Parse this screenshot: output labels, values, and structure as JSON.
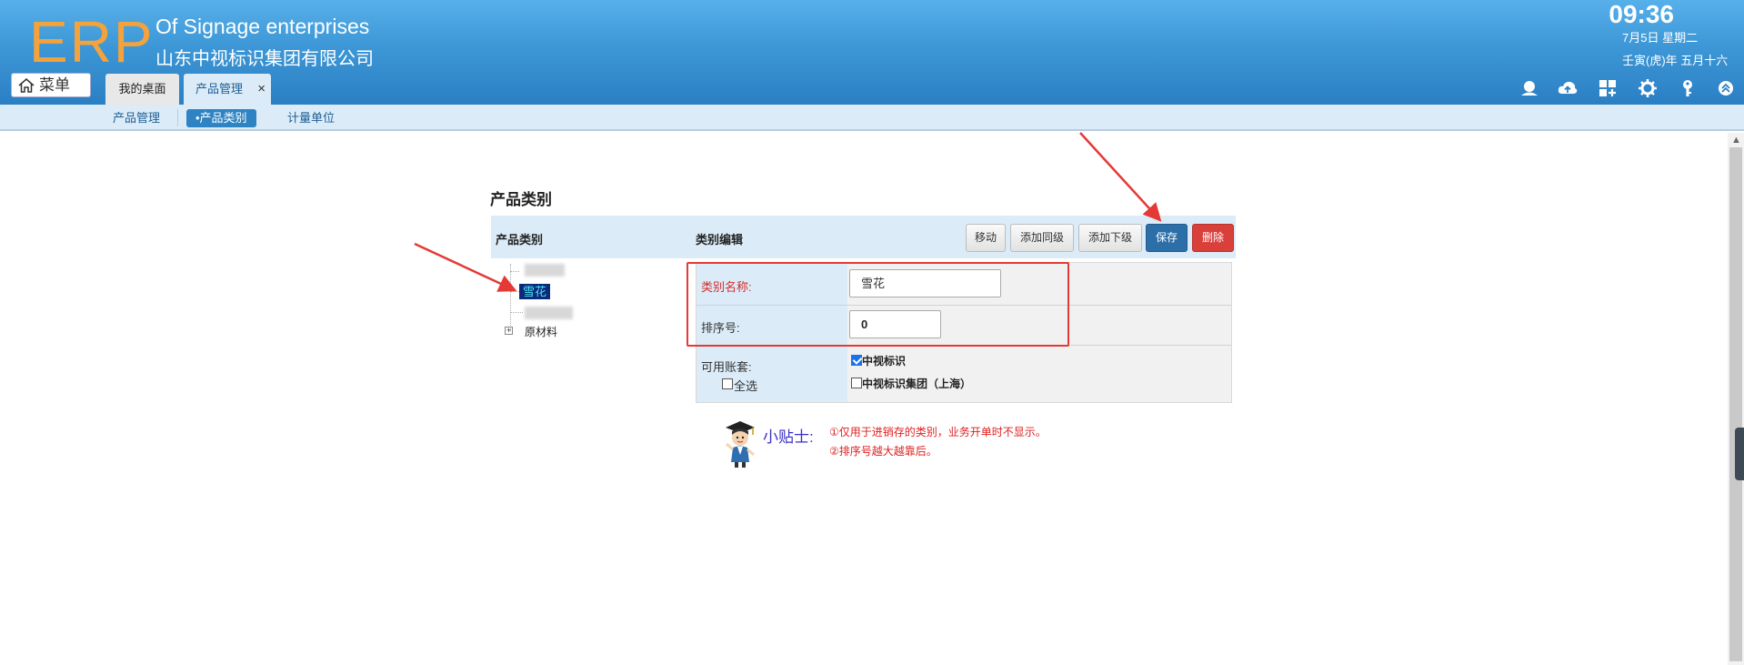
{
  "header": {
    "logo": "ERP",
    "company_en": "Of Signage enterprises",
    "company_cn": "山东中视标识集团有限公司",
    "time": "09:36",
    "date": "7月5日 星期二",
    "lunar_date": "壬寅(虎)年 五月十六",
    "menu_label": "菜单",
    "tabs": [
      {
        "label": "我的桌面"
      },
      {
        "label": "产品管理",
        "close": "×"
      }
    ],
    "icons": [
      "user-icon",
      "cloud-upload-icon",
      "apps-icon",
      "gear-icon",
      "key-icon",
      "collapse-up-icon"
    ]
  },
  "subnav": {
    "items": [
      {
        "label": "产品管理"
      },
      {
        "label": "•产品类别"
      },
      {
        "label": "计量单位"
      }
    ]
  },
  "main": {
    "heading": "产品类别",
    "panel": {
      "tree_header": "产品类别",
      "edit_header": "类别编辑",
      "buttons": {
        "move": "移动",
        "add_sibling": "添加同级",
        "add_child": "添加下级",
        "save": "保存",
        "delete": "删除"
      }
    },
    "tree": {
      "selected": "雪花",
      "raw_material": "原材料",
      "expander": "+"
    },
    "form": {
      "name_label": "类别名称:",
      "name_value": "雪花",
      "order_label": "排序号:",
      "order_value": "0",
      "accounts_label": "可用账套:",
      "select_all_label": "全选",
      "select_all_checked": false,
      "accounts": [
        {
          "label": "中视标识",
          "checked": true
        },
        {
          "label": "中视标识集团（上海）",
          "checked": false
        }
      ]
    },
    "tips": {
      "title": "小贴士:",
      "lines": [
        "①仅用于进销存的类别，业务开单时不显示。",
        "②排序号越大越靠后。"
      ]
    }
  },
  "colors": {
    "header_blue": "#3d97d6",
    "logo_orange": "#f4a23b",
    "save_blue": "#2c6ea8",
    "delete_red": "#d9403a",
    "annotation_red": "#e53935"
  }
}
